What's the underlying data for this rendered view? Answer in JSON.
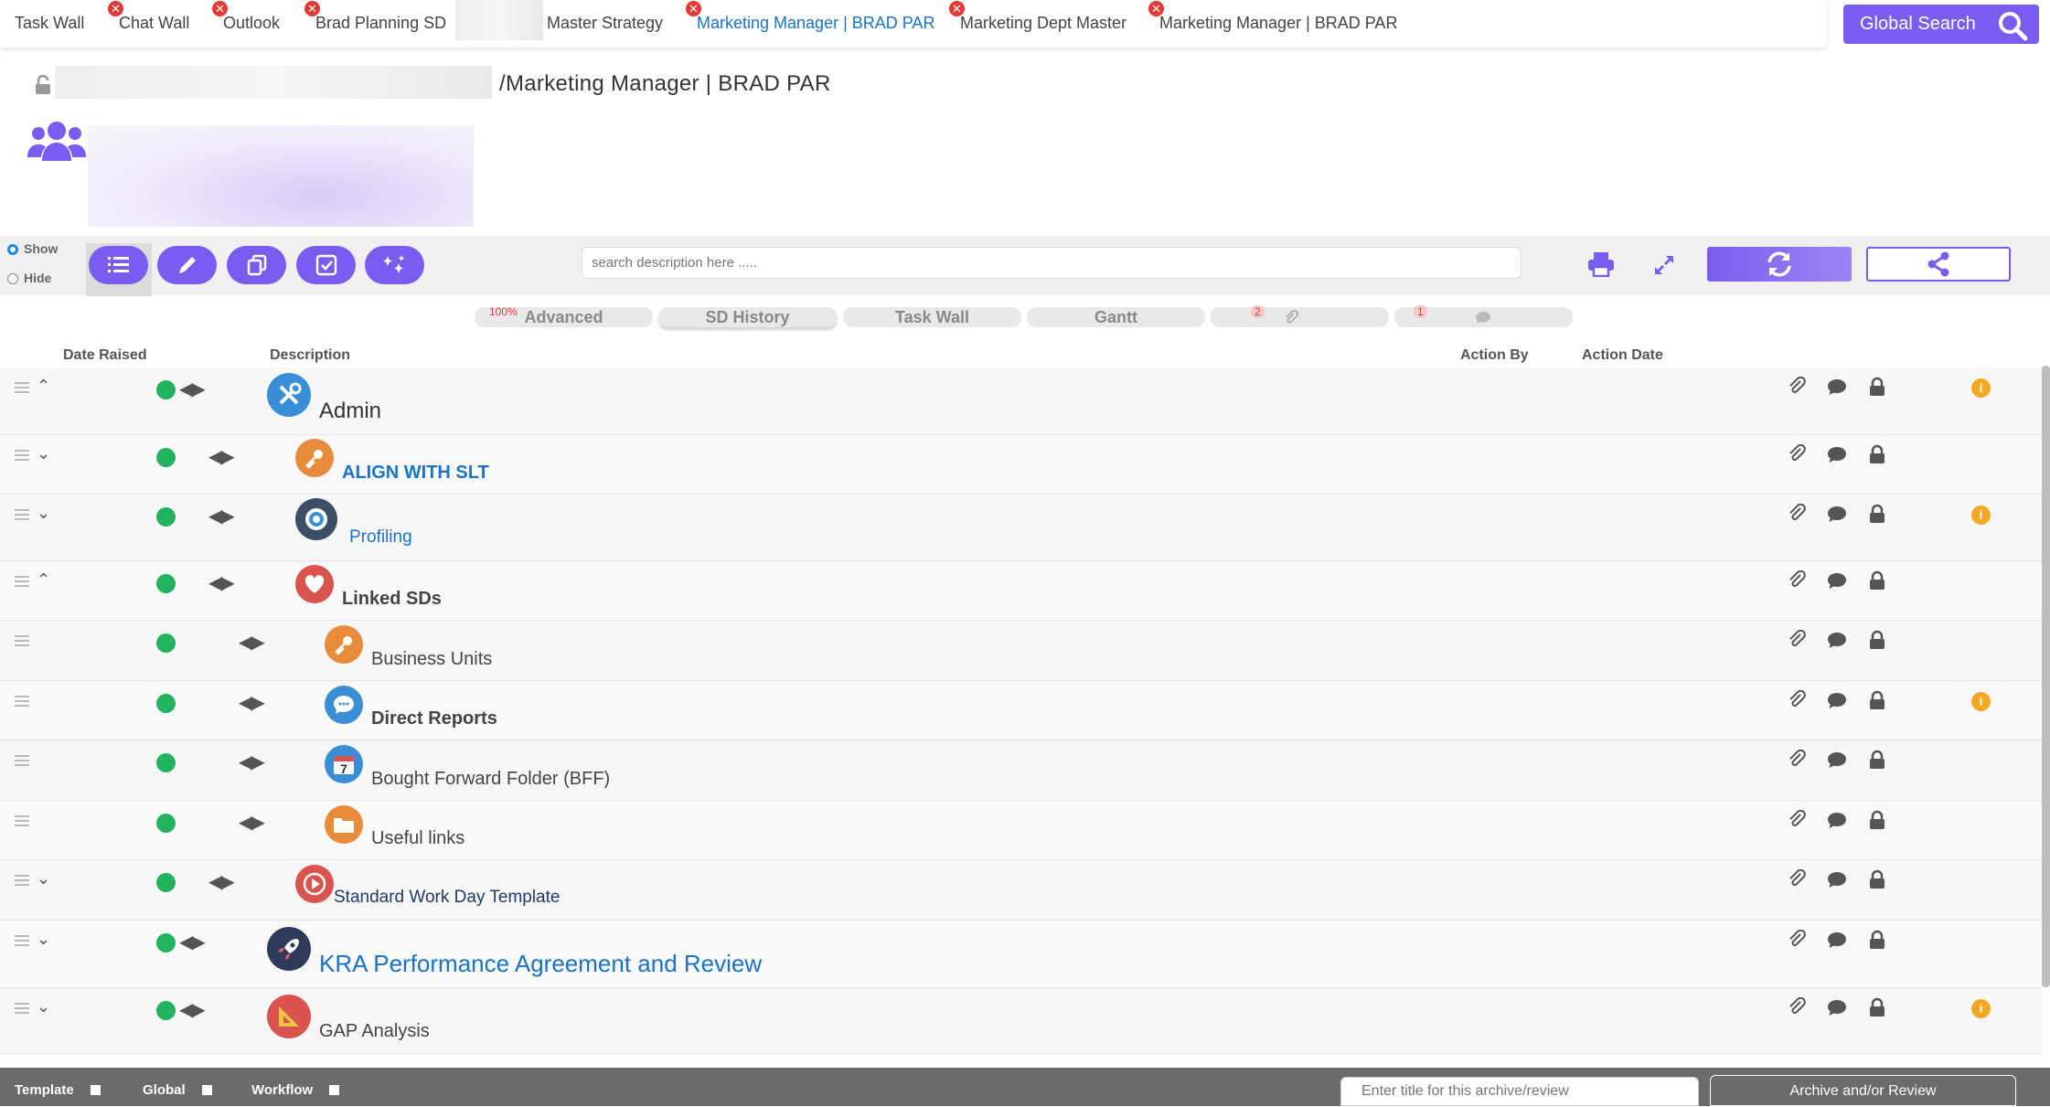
{
  "tabs": [
    {
      "label": "Task Wall",
      "closable": false,
      "active": false
    },
    {
      "label": "Chat Wall",
      "closable": true,
      "active": false
    },
    {
      "label": "Outlook",
      "closable": true,
      "active": false
    },
    {
      "label": "Brad Planning SD",
      "closable": true,
      "active": false
    },
    {
      "label": "Master Strategy",
      "closable": false,
      "active": false
    },
    {
      "label": "Marketing Manager | BRAD PAR",
      "closable": true,
      "active": true
    },
    {
      "label": "Marketing Dept Master",
      "closable": true,
      "active": false
    },
    {
      "label": "Marketing Manager | BRAD PAR",
      "closable": true,
      "active": false
    }
  ],
  "close_glyph": "✕",
  "global_search": "Global Search",
  "header": {
    "path": "/Marketing Manager | BRAD PAR"
  },
  "toolbar": {
    "show": "Show",
    "hide": "Hide",
    "search_placeholder": "search description here .....",
    "buttons": [
      "list-icon",
      "pencil-icon",
      "copy-icon",
      "checkbox-icon",
      "magic-icon"
    ]
  },
  "view_tabs": [
    {
      "label": "Advanced",
      "badge": "100%"
    },
    {
      "label": "SD History",
      "badge": ""
    },
    {
      "label": "Task Wall",
      "badge": ""
    },
    {
      "label": "Gantt",
      "badge": ""
    },
    {
      "label": "",
      "badge": "2",
      "icon": "paperclip-icon"
    },
    {
      "label": "",
      "badge": "1",
      "icon": "comment-icon"
    }
  ],
  "columns": {
    "date_raised": "Date Raised",
    "description": "Description",
    "action_by": "Action By",
    "action_date": "Action Date"
  },
  "rows": [
    {
      "title": "Admin",
      "icon": "tools-icon",
      "info": true
    },
    {
      "title": "ALIGN WITH SLT",
      "icon": "key-icon",
      "info": false
    },
    {
      "title": "Profiling",
      "icon": "target-icon",
      "info": true
    },
    {
      "title": "Linked SDs",
      "icon": "heart-icon",
      "info": false
    },
    {
      "title": "Business Units",
      "icon": "key-icon",
      "info": false
    },
    {
      "title": "Direct Reports",
      "icon": "chat-bubble-icon",
      "info": true
    },
    {
      "title": "Bought Forward Folder (BFF)",
      "icon": "calendar-icon",
      "calendar_day": "7",
      "info": false
    },
    {
      "title": "Useful links",
      "icon": "folder-icon",
      "info": false
    },
    {
      "title": "Standard Work Day Template",
      "icon": "play-icon",
      "info": false
    },
    {
      "title": "KRA Performance Agreement and Review",
      "icon": "rocket-icon",
      "info": false
    },
    {
      "title": "GAP Analysis",
      "icon": "ruler-icon",
      "info": true
    }
  ],
  "footer": {
    "template": "Template",
    "global": "Global",
    "workflow": "Workflow",
    "archive_placeholder": "Enter title for this archive/review",
    "archive_button": "Archive and/or Review"
  },
  "colors": {
    "accent": "#7a5df0",
    "green": "#22b35e",
    "info": "#f5a623",
    "link_blue": "#1a73c8"
  }
}
